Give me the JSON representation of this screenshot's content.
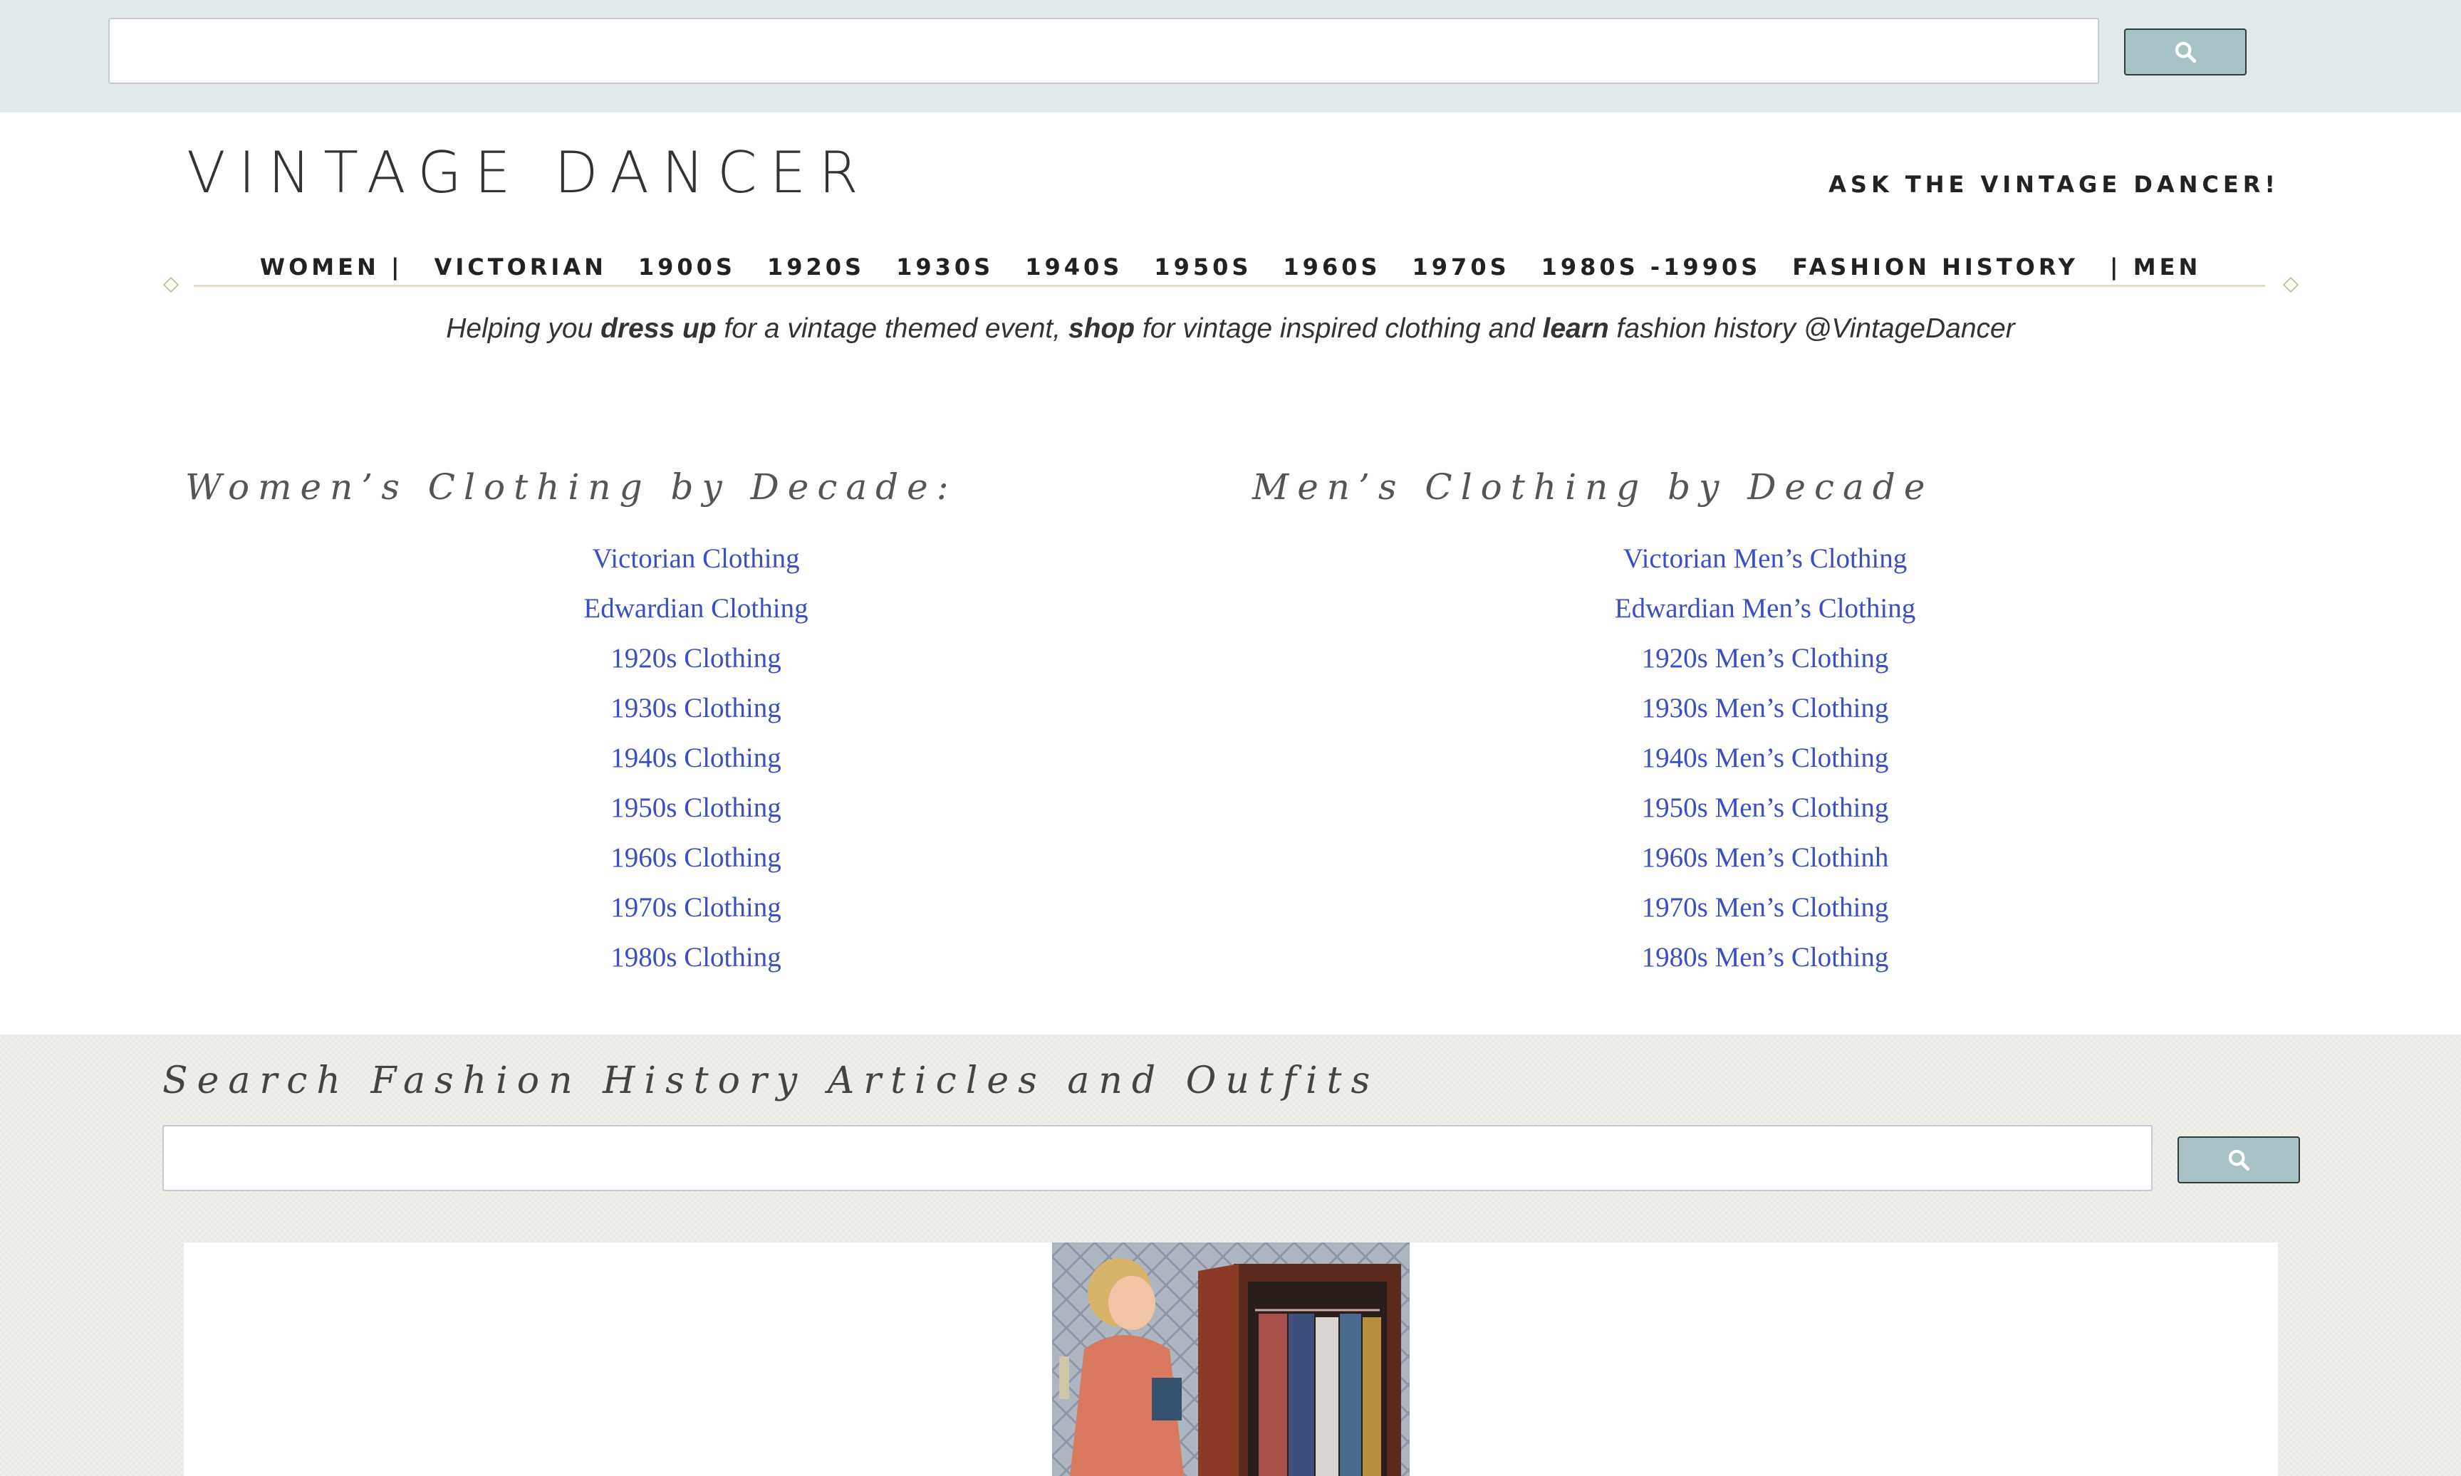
{
  "top_search": {
    "placeholder": "",
    "button_icon": "search-icon"
  },
  "header": {
    "logo": "VINTAGE DANCER",
    "ask_link": "ASK THE VINTAGE DANCER!"
  },
  "nav": {
    "items": [
      "WOMEN |",
      "VICTORIAN",
      "1900S",
      "1920S",
      "1930S",
      "1940S",
      "1950S",
      "1960S",
      "1970S",
      "1980S -1990S",
      "FASHION HISTORY",
      "| MEN"
    ]
  },
  "tagline": {
    "part1": "Helping you ",
    "bold1": "dress up",
    "part2": " for a vintage themed event, ",
    "bold2": "shop",
    "part3": " for vintage inspired clothing and ",
    "bold3": "learn",
    "part4": " fashion history @VintageDancer"
  },
  "womens": {
    "heading": "Women’s Clothing by Decade:",
    "links": [
      "Victorian Clothing",
      "Edwardian Clothing",
      "1920s Clothing",
      "1930s Clothing",
      "1940s Clothing",
      "1950s Clothing",
      "1960s Clothing",
      "1970s Clothing",
      "1980s Clothing"
    ]
  },
  "mens": {
    "heading": "Men’s Clothing by Decade",
    "links": [
      "Victorian Men’s Clothing",
      "Edwardian Men’s Clothing",
      "1920s Men’s Clothing",
      "1930s Men’s Clothing",
      "1940s Men’s Clothing",
      "1950s Men’s Clothing",
      "1960s Men’s Clothinh",
      "1970s Men’s Clothing",
      "1980s Men’s Clothing"
    ]
  },
  "lower_search": {
    "heading": "Search Fashion History Articles and Outfits",
    "placeholder": "",
    "button_icon": "search-icon"
  },
  "colors": {
    "link": "#3a4fc4",
    "topbar_bg": "#e2eaec",
    "search_button": "#a8c2c5",
    "lower_bg": "#f1efe9"
  },
  "image": {
    "icon": "vintage-wardrobe-illustration"
  }
}
